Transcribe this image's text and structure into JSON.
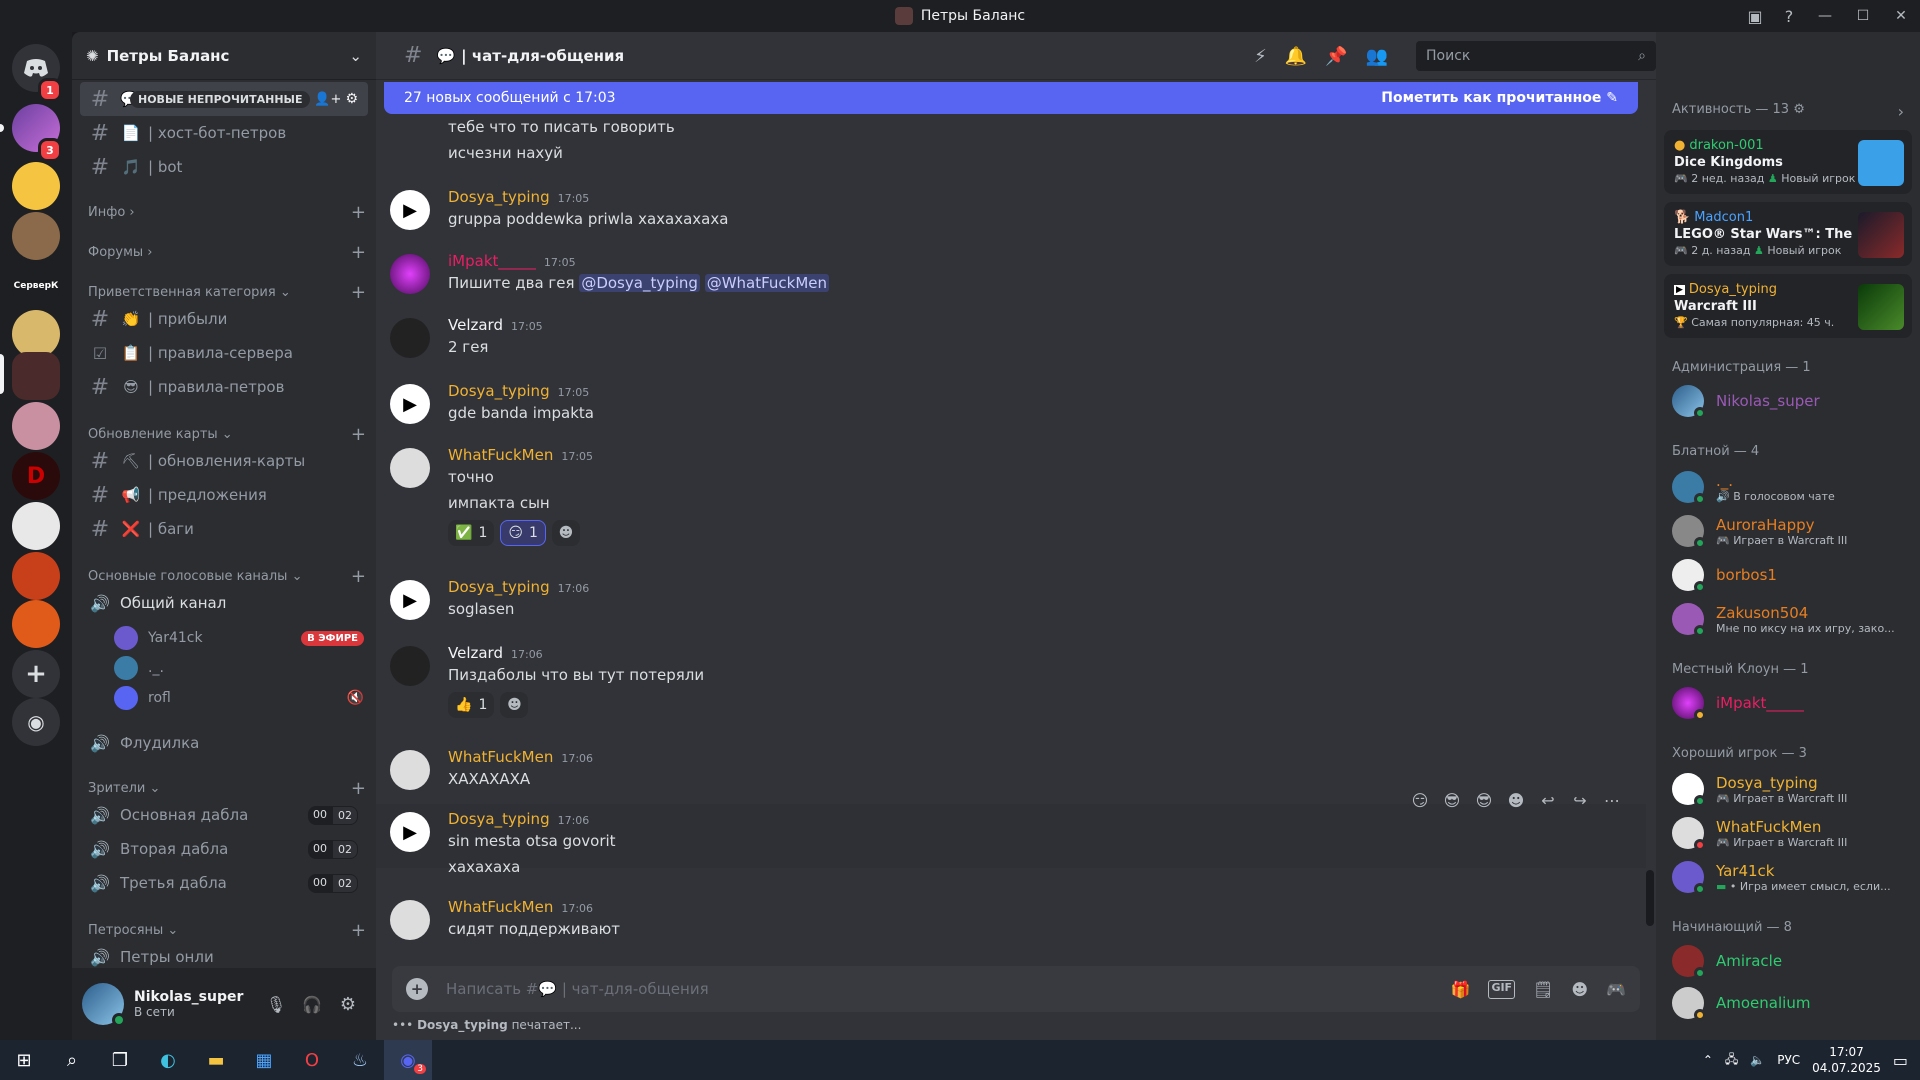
{
  "window": {
    "title": "Петры Баланс"
  },
  "server": {
    "name": "Петры Баланс"
  },
  "channels": {
    "top": [
      {
        "label": "| хост-бот-петров",
        "emoji": "📄"
      },
      {
        "label": "| bot",
        "emoji": "🎵"
      }
    ],
    "new_unread_label": "НОВЫЕ НЕПРОЧИТАННЫЕ",
    "cat_info": "Инфо",
    "cat_forums": "Форумы",
    "cat_welcome": "Приветственная категория",
    "welcome": [
      {
        "label": "| прибыли",
        "emoji": "👏"
      },
      {
        "label": "| правила-сервера",
        "emoji": "📋"
      },
      {
        "label": "| правила-петров",
        "emoji": "😎"
      }
    ],
    "cat_updates": "Обновление карты",
    "updates": [
      {
        "label": "| обновления-карты",
        "emoji": "⛏"
      },
      {
        "label": "| предложения",
        "emoji": "📢"
      },
      {
        "label": "| баги",
        "emoji": "❌"
      }
    ],
    "cat_voice": "Основные голосовые каналы",
    "voice_general": "Общий канал",
    "voice_users": [
      {
        "name": "Yar41ck",
        "live": "В ЭФИРЕ"
      },
      {
        "name": "._."
      },
      {
        "name": "rofl"
      }
    ],
    "voice_flood": "Флудилка",
    "cat_viewers": "Зрители",
    "viewers": [
      {
        "label": "Основная дабла",
        "a": "00",
        "b": "02"
      },
      {
        "label": "Вторая дабла",
        "a": "00",
        "b": "02"
      },
      {
        "label": "Третья дабла",
        "a": "00",
        "b": "02"
      }
    ],
    "cat_petro": "Петросяны",
    "petro_online": "Петры онли"
  },
  "user": {
    "name": "Nikolas_super",
    "status": "В сети"
  },
  "header": {
    "channel": "| чат-для-общения",
    "search_placeholder": "Поиск"
  },
  "unread_bar": {
    "text": "27 новых сообщений с 17:03",
    "action": "Пометить как прочитанное"
  },
  "messages": [
    {
      "type": "cont",
      "text": "тебе что то писать говорить"
    },
    {
      "type": "cont",
      "text": "исчезни нахуй"
    },
    {
      "name": "Dosya_typing",
      "time": "17:05",
      "text": "gruppa poddewka priwla xaxaxaxaxa"
    },
    {
      "name": "iMpakt_____",
      "time": "17:05",
      "text": "Пишите два гея",
      "m1": "@Dosya_typing",
      "m2": "@WhatFuckMen"
    },
    {
      "name": "Velzard",
      "time": "17:05",
      "text": "2 гея"
    },
    {
      "name": "Dosya_typing",
      "time": "17:05",
      "text": "gde banda impakta"
    },
    {
      "name": "WhatFuckMen",
      "time": "17:05",
      "text": "точно",
      "text2": "импакта сын",
      "r1": "1",
      "r2": "1"
    },
    {
      "name": "Dosya_typing",
      "time": "17:06",
      "text": "soglasen"
    },
    {
      "name": "Velzard",
      "time": "17:06",
      "text": "Пиздаболы что вы тут потеряли",
      "r1": "1"
    },
    {
      "name": "WhatFuckMen",
      "time": "17:06",
      "text": "ХАХАХАХА"
    },
    {
      "name": "Dosya_typing",
      "time": "17:06",
      "text": "sin mesta otsa govorit",
      "text2": "хахахаха"
    },
    {
      "name": "WhatFuckMen",
      "time": "17:06",
      "text": "сидят поддерживают"
    }
  ],
  "composer": {
    "placeholder": "Написать #💬 | чат-для-общения"
  },
  "typing": {
    "user": "Dosya_typing",
    "text": "печатает..."
  },
  "members": {
    "activity_header": "Активность — 13",
    "activities": [
      {
        "user": "drakon-001",
        "game": "Dice Kingdoms",
        "meta": "2 нед. назад",
        "tag": "Новый игрок"
      },
      {
        "user": "Madcon1",
        "game": "LEGO® Star Wars™: The Sk...",
        "meta": "2 д. назад",
        "tag": "Новый игрок"
      },
      {
        "user": "Dosya_typing",
        "game": "Warcraft III",
        "meta": "Самая популярная: 45 ч."
      }
    ],
    "sec_admin": "Администрация — 1",
    "admin": [
      {
        "name": "Nikolas_super"
      }
    ],
    "sec_blatnoy": "Блатной — 4",
    "blatnoy": [
      {
        "name": "._.",
        "sub": "В голосовом чате"
      },
      {
        "name": "AuroraHappy",
        "sub": "Играет в Warcraft III"
      },
      {
        "name": "borbos1",
        "sub": ""
      },
      {
        "name": "Zakuson504",
        "sub": "Мне по иксу на их игру, зако..."
      }
    ],
    "sec_clown": "Местный Клоун — 1",
    "clown": [
      {
        "name": "iMpakt_____"
      }
    ],
    "sec_good": "Хороший игрок — 3",
    "good": [
      {
        "name": "Dosya_typing",
        "sub": "Играет в Warcraft III"
      },
      {
        "name": "WhatFuckMen",
        "sub": "Играет в Warcraft III"
      },
      {
        "name": "Yar41ck",
        "sub": "• Игра имеет смысл, если..."
      }
    ],
    "sec_new": "Начинающий — 8",
    "newbies": [
      {
        "name": "Amiracle"
      },
      {
        "name": "Amoenalium"
      }
    ]
  },
  "taskbar": {
    "lang": "РУС",
    "time": "17:07",
    "date": "04.07.2025"
  },
  "guild_labels": {
    "server_k": "СерверК"
  },
  "badges": {
    "home": "1",
    "g1": "3",
    "discord": "3"
  },
  "colors": {
    "accent": "#5865f2",
    "yellow": "#f0b232",
    "pink": "#e91e63",
    "red": "#f23f43",
    "orange": "#e67e22",
    "purple": "#9b59b6",
    "green": "#2ecc71"
  }
}
